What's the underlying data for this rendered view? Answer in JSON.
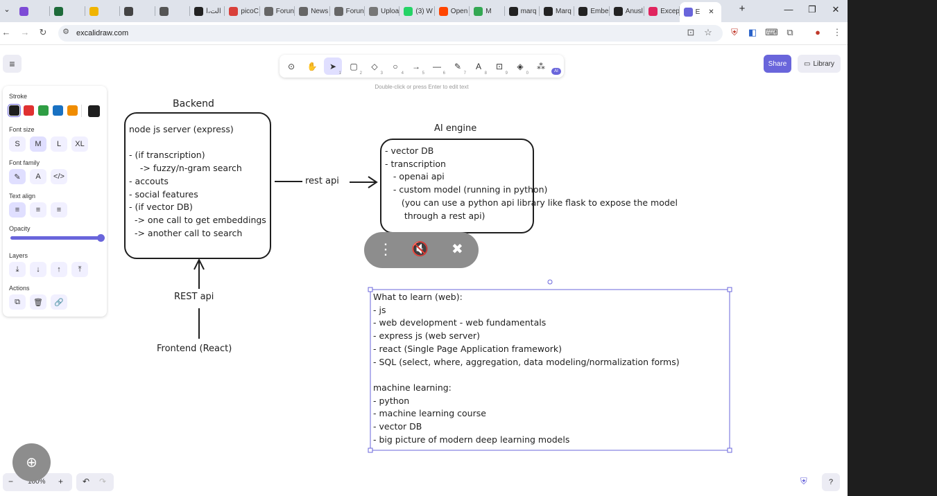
{
  "browser": {
    "tabs": [
      {
        "label": "",
        "color": "#7d4bd6"
      },
      {
        "label": "",
        "color": "#1e6b3a"
      },
      {
        "label": "",
        "color": "#f0b400"
      },
      {
        "label": "",
        "color": "#444444"
      },
      {
        "label": "",
        "color": "#555555"
      },
      {
        "label": "الت،ا",
        "color": "#222222"
      },
      {
        "label": "picoC",
        "color": "#d9403a"
      },
      {
        "label": "Forun",
        "color": "#666666"
      },
      {
        "label": "News",
        "color": "#666666"
      },
      {
        "label": "Forun",
        "color": "#666666"
      },
      {
        "label": "Uploa",
        "color": "#777777"
      },
      {
        "label": "(3) W",
        "color": "#25d366"
      },
      {
        "label": "Open",
        "color": "#ff4500"
      },
      {
        "label": "M",
        "color": "#34a853"
      },
      {
        "label": "marq",
        "color": "#222222"
      },
      {
        "label": "Marq",
        "color": "#222222"
      },
      {
        "label": "Embe",
        "color": "#222222"
      },
      {
        "label": "Anusl",
        "color": "#222222"
      },
      {
        "label": "Excep",
        "color": "#e0245e"
      },
      {
        "label": "E",
        "color": "#6965db",
        "active": true
      }
    ],
    "new_tab": "+",
    "minimize": "—",
    "restore": "❐",
    "close": "✕",
    "url": "excalidraw.com"
  },
  "toolbar": {
    "tools": [
      {
        "name": "lock",
        "glyph": "⊙",
        "key": ""
      },
      {
        "name": "hand",
        "glyph": "✋",
        "key": ""
      },
      {
        "name": "selection",
        "glyph": "➤",
        "key": "1",
        "selected": true
      },
      {
        "name": "rectangle",
        "glyph": "▢",
        "key": "2"
      },
      {
        "name": "diamond",
        "glyph": "◇",
        "key": "3"
      },
      {
        "name": "ellipse",
        "glyph": "○",
        "key": "4"
      },
      {
        "name": "arrow",
        "glyph": "→",
        "key": "5"
      },
      {
        "name": "line",
        "glyph": "—",
        "key": "6"
      },
      {
        "name": "draw",
        "glyph": "✎",
        "key": "7"
      },
      {
        "name": "text",
        "glyph": "A",
        "key": "8"
      },
      {
        "name": "image",
        "glyph": "⊡",
        "key": "9"
      },
      {
        "name": "eraser",
        "glyph": "◈",
        "key": "0"
      },
      {
        "name": "more",
        "glyph": "⁂",
        "key": ""
      }
    ],
    "ai_badge": "AI",
    "hint": "Double-click or press Enter to edit text"
  },
  "top_right": {
    "share": "Share",
    "library": "Library"
  },
  "menu_icon": "≡",
  "panel": {
    "stroke_label": "Stroke",
    "stroke_colors": [
      "#1e1e1e",
      "#e03131",
      "#2f9e44",
      "#1971c2",
      "#f08c00"
    ],
    "stroke_current": "#1e1e1e",
    "font_size_label": "Font size",
    "font_sizes": [
      "S",
      "M",
      "L",
      "XL"
    ],
    "font_family_label": "Font family",
    "font_families": [
      "✎",
      "A",
      "</>"
    ],
    "text_align_label": "Text align",
    "text_aligns": [
      "≡",
      "≡",
      "≡"
    ],
    "opacity_label": "Opacity",
    "opacity": 100,
    "layers_label": "Layers",
    "layer_buttons": [
      "⤓",
      "↓",
      "↑",
      "⤒"
    ],
    "actions_label": "Actions",
    "action_buttons": [
      "⧉",
      "🗑",
      "🔗"
    ]
  },
  "drawing": {
    "backend_title": "Backend",
    "backend_lines": [
      "node js server (express)",
      "",
      "- (if transcription)",
      "    -> fuzzy/n-gram search",
      "- accouts",
      "- social features",
      "- (if vector DB)",
      "  -> one call to get embeddings",
      "  -> another call to search"
    ],
    "rest_api_arrow": "rest api",
    "ai_title": "AI engine",
    "ai_lines": [
      "- vector DB",
      "- transcription",
      "   - openai api",
      "   - custom model (running in python)",
      "      (you can use a python api library like flask to expose the model",
      "       through a rest api)"
    ],
    "rest_api_vertical": "REST api",
    "frontend": "Frontend (React)",
    "learn_lines": [
      "What to learn (web):",
      "- js",
      "- web development - web fundamentals",
      "- express js (web server)",
      "- react (Single Page Application framework)",
      "- SQL (select, where, aggregation, data modeling/normalization forms)",
      "",
      "machine learning:",
      "- python",
      "- machine learning course",
      "- vector DB",
      "- big picture of modern deep learning models"
    ]
  },
  "overlay": {
    "more": "⋮",
    "mute": "🔇",
    "unpin": "✖"
  },
  "bottom": {
    "zoom_out": "−",
    "zoom": "100%",
    "zoom_in": "+",
    "undo": "↶",
    "redo": "↷",
    "help": "?"
  }
}
